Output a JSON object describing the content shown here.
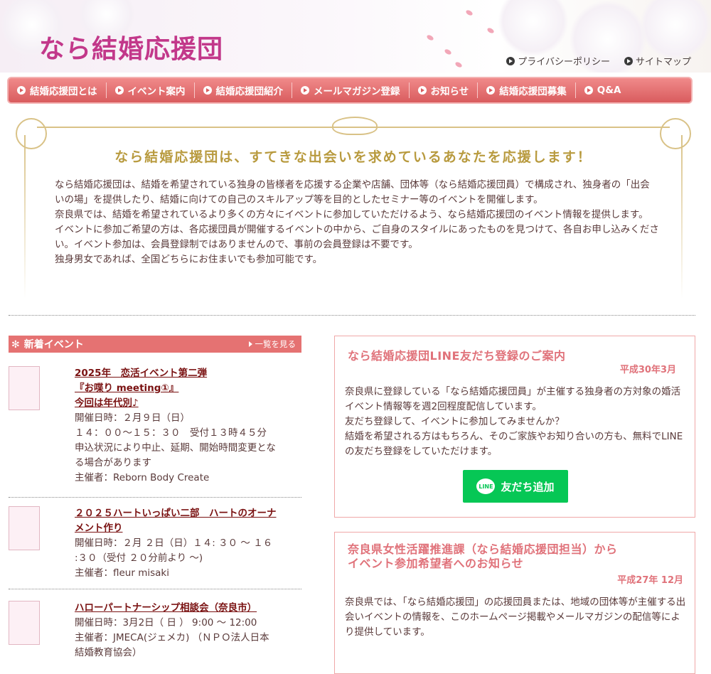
{
  "header": {
    "logo_text": "なら結婚応援団",
    "links": [
      {
        "label": "プライバシーポリシー"
      },
      {
        "label": "サイトマップ"
      }
    ]
  },
  "nav": {
    "items": [
      {
        "label": "結婚応援団とは"
      },
      {
        "label": "イベント案内"
      },
      {
        "label": "結婚応援団紹介"
      },
      {
        "label": "メールマガジン登録"
      },
      {
        "label": "お知らせ"
      },
      {
        "label": "結婚応援団募集"
      },
      {
        "label": "Q&A"
      }
    ]
  },
  "intro": {
    "heading": "なら結婚応援団は、すてきな出会いを求めているあなたを応援します！",
    "paragraphs": [
      "なら結婚応援団は、結婚を希望されている独身の皆様者を応援する企業や店舗、団体等（なら結婚応援団員）で構成され、独身者の「出会いの場」を提供したり、結婚に向けての自己のスキルアップ等を目的としたセミナー等のイベントを開催します。",
      "奈良県では、結婚を希望されているより多くの方々にイベントに参加していただけるよう、なら結婚応援団のイベント情報を提供します。",
      "イベントに参加ご希望の方は、各応援団員が開催するイベントの中から、ご自身のスタイルにあったものを見つけて、各自お申し込みください。イベント参加は、会員登録制ではありませんので、事前の会員登録は不要です。",
      "独身男女であれば、全国どちらにお住まいでも参加可能です。"
    ]
  },
  "events": {
    "header": "新着イベント",
    "see_all": "一覧を見る",
    "items": [
      {
        "title_lines": [
          "2025年　恋活イベント第二弾",
          "『お喋り meeting①』",
          "今回は年代別♪"
        ],
        "lines": [
          "開催日時：２月９日（日）",
          "１４：００〜１５：３０　受付１３時４５分",
          "申込状況により中止、延期、開始時間変更とな",
          "る場合があります",
          "主催者：Reborn Body Create"
        ]
      },
      {
        "title_lines": [
          "２０２５ハートいっぱい二部　ハートのオーナ",
          "メント作り"
        ],
        "lines": [
          "開催日時：２月 ２日（日）１４: ３０ 〜 １６",
          ":３０（受付 ２０分前より 〜)",
          "主催者：fleur misaki"
        ]
      },
      {
        "title_lines": [
          "ハローパートナーシップ相談会（奈良市）"
        ],
        "lines": [
          "開催日時：3月2日（ 日 ） 9:00 〜 12:00",
          "主催者：JMECA(ジェメカ) （ＮＰＯ法人日本",
          "結婚教育協会）"
        ]
      }
    ]
  },
  "line_box": {
    "title": "なら結婚応援団LINE友だち登録のご案内",
    "date": "平成30年3月",
    "paragraphs": [
      "奈良県に登録している「なら結婚応援団員」が主催する独身者の方対象の婚活イベント情報等を週2回程度配信しています。",
      "友だち登録して、イベントに参加してみませんか？",
      "結婚を希望される方はもちろん、そのご家族やお知り合いの方も、無料でLINEの友だち登録をしていただけます。"
    ],
    "button_label": "友だち追加",
    "button_icon_text": "LINE"
  },
  "notice_box": {
    "title_lines": [
      "奈良県女性活躍推進課（なら結婚応援団担当）から",
      "イベント参加希望者へのお知らせ"
    ],
    "date": "平成27年 12月",
    "paragraphs": [
      "奈良県では、「なら結婚応援団」の応援団員または、地域の団体等が主催する出会いイベントの情報を、このホームページ掲載やメールマガジンの配信等により提供しています。"
    ]
  },
  "colors": {
    "logo": "#c2388a",
    "nav": "#e06a6a",
    "gold": "#b89a3e",
    "accent": "#e0727a",
    "line_green": "#06c755",
    "event_title": "#7a1212"
  }
}
